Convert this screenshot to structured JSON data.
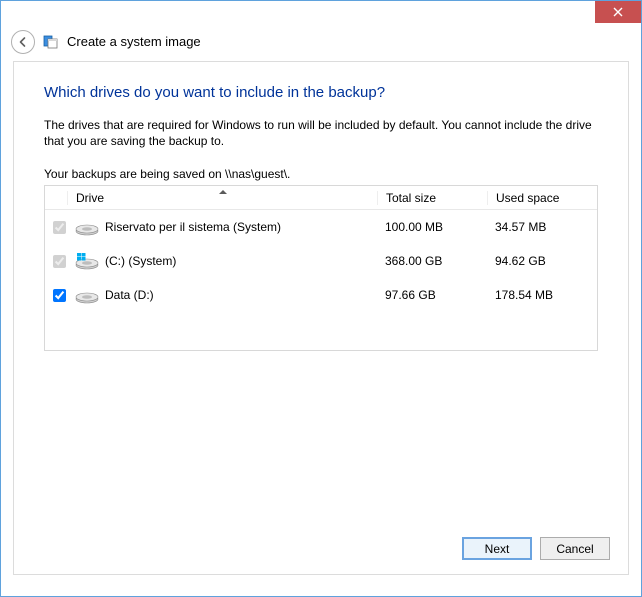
{
  "window": {
    "title": "Create a system image"
  },
  "page": {
    "heading": "Which drives do you want to include in the backup?",
    "explain": "The drives that are required for Windows to run will be included by default. You cannot include the drive that you are saving the backup to.",
    "save_location_line": "Your backups are being saved on \\\\nas\\guest\\."
  },
  "table": {
    "columns": {
      "drive": "Drive",
      "total": "Total size",
      "used": "Used space"
    },
    "rows": [
      {
        "checked": true,
        "disabled": true,
        "icon": "drive",
        "name": "Riservato per il sistema (System)",
        "total": "100.00 MB",
        "used": "34.57 MB"
      },
      {
        "checked": true,
        "disabled": true,
        "icon": "drive-win",
        "name": "(C:) (System)",
        "total": "368.00 GB",
        "used": "94.62 GB"
      },
      {
        "checked": true,
        "disabled": false,
        "icon": "drive",
        "name": "Data (D:)",
        "total": "97.66 GB",
        "used": "178.54 MB"
      }
    ]
  },
  "buttons": {
    "next": "Next",
    "cancel": "Cancel"
  }
}
